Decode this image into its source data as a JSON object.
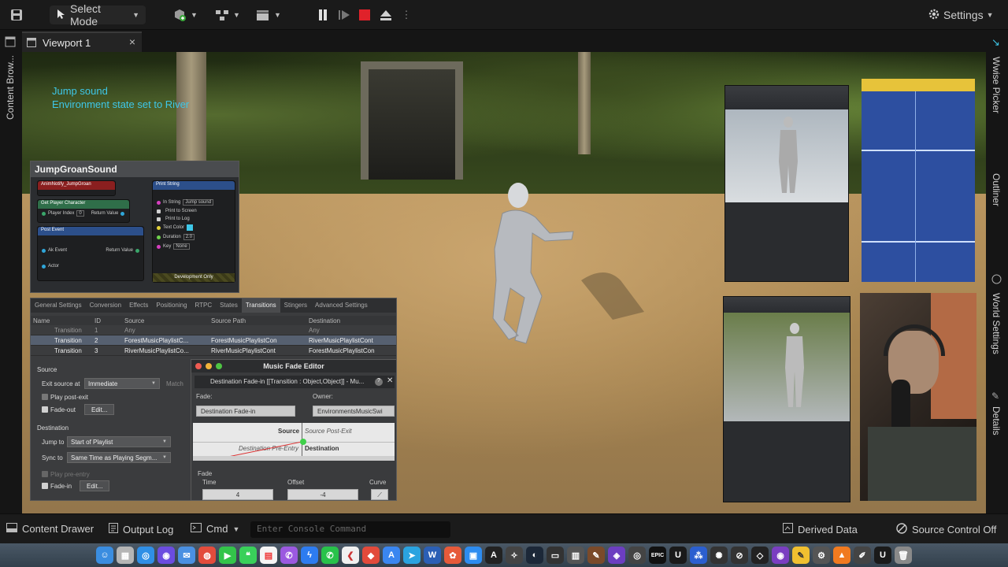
{
  "toolbar": {
    "select_mode": "Select Mode",
    "settings": "Settings"
  },
  "tabs": {
    "viewport": "Viewport 1",
    "close": "×"
  },
  "side_tabs": {
    "left": [
      "Content Brow..."
    ],
    "right": [
      "Wwise Picker",
      "Outliner",
      "World Settings",
      "Details"
    ]
  },
  "hud": {
    "line1": "Jump sound",
    "line2": "Environment state set to River"
  },
  "blueprint": {
    "title": "JumpGroanSound",
    "anim_notify": "AnimNotify_JumpGroan",
    "get_player": "Get Player Character",
    "player_index": "Player Index",
    "player_index_val": "0",
    "return_value": "Return Value",
    "post_event": "Post Event",
    "ak_event": "Ak Event",
    "actor": "Actor",
    "print_string": "Print String",
    "in_string": "In String",
    "in_string_val": "Jump sound",
    "print_screen": "Print to Screen",
    "print_log": "Print to Log",
    "text_color": "Text Color",
    "duration": "Duration",
    "duration_val": "2.0",
    "key": "Key",
    "key_val": "None",
    "dev_only": "Development Only"
  },
  "transitions": {
    "tabs": [
      "General Settings",
      "Conversion",
      "Effects",
      "Positioning",
      "RTPC",
      "States",
      "Transitions",
      "Stingers",
      "Advanced Settings"
    ],
    "active_tab": "Transitions",
    "columns": [
      "Name",
      "ID",
      "Source",
      "Source Path",
      "Destination"
    ],
    "rows": [
      {
        "name": "Transition",
        "id": "1",
        "source": "Any",
        "path": "",
        "dest": "Any"
      },
      {
        "name": "Transition",
        "id": "2",
        "source": "ForestMusicPlaylistC...",
        "path": "ForestMusicPlaylistCon",
        "dest": "RiverMusicPlaylistCont"
      },
      {
        "name": "Transition",
        "id": "3",
        "source": "RiverMusicPlaylistCo...",
        "path": "RiverMusicPlaylistCont",
        "dest": "ForestMusicPlaylistCon"
      }
    ],
    "source_label": "Source",
    "exit_label": "Exit source at",
    "exit_value": "Immediate",
    "match_label": "Match",
    "play_post_exit": "Play post-exit",
    "fade_out": "Fade-out",
    "edit": "Edit...",
    "destination_label": "Destination",
    "jump_label": "Jump to",
    "jump_value": "Start of Playlist",
    "sync_label": "Sync to",
    "sync_value": "Same Time as Playing Segm...",
    "play_pre_entry": "Play pre-entry",
    "fade_in": "Fade-in",
    "edit2": "Edit..."
  },
  "fade_editor": {
    "title": "Music Fade Editor",
    "bar": "Destination Fade-in [[Transition : Object,Object]] - Mu...",
    "fade_label": "Fade:",
    "fade_value": "Destination Fade-in",
    "owner_label": "Owner:",
    "owner_value": "EnvironmentsMusicSwi",
    "source": "Source",
    "source_post_exit": "Source Post-Exit",
    "dest_pre_entry": "Destination Pre-Entry",
    "destination": "Destination",
    "fade_section": "Fade",
    "time_label": "Time",
    "time_value": "4",
    "offset_label": "Offset",
    "offset_value": "-4",
    "curve_label": "Curve"
  },
  "statusbar": {
    "content_drawer": "Content Drawer",
    "output_log": "Output Log",
    "cmd": "Cmd",
    "console_placeholder": "Enter Console Command",
    "derived_data": "Derived Data",
    "source_control": "Source Control Off"
  },
  "colors": {
    "hud_cyan": "#3ec7e8",
    "accent_blue": "#2d4fa0",
    "stop_red": "#e0222a"
  }
}
